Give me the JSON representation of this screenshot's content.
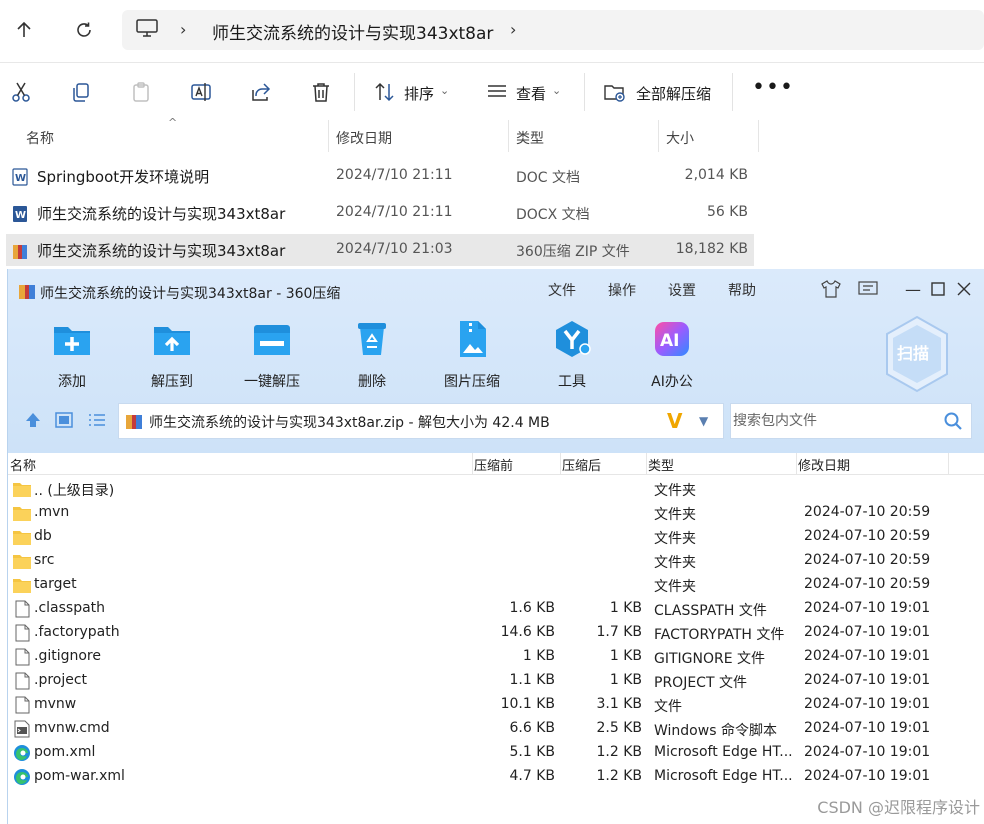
{
  "explorer": {
    "path": "师生交流系统的设计与实现343xt8ar",
    "toolbar": {
      "sort_label": "排序",
      "view_label": "查看",
      "extract_all_label": "全部解压缩"
    },
    "columns": {
      "name": "名称",
      "date": "修改日期",
      "type": "类型",
      "size": "大小"
    },
    "files": [
      {
        "name": "Springboot开发环境说明",
        "date": "2024/7/10 21:11",
        "type": "DOC 文档",
        "size": "2,014 KB"
      },
      {
        "name": "师生交流系统的设计与实现343xt8ar",
        "date": "2024/7/10 21:11",
        "type": "DOCX 文档",
        "size": "56 KB"
      },
      {
        "name": "师生交流系统的设计与实现343xt8ar",
        "date": "2024/7/10 21:03",
        "type": "360压缩 ZIP 文件",
        "size": "18,182 KB"
      }
    ]
  },
  "zip": {
    "title": "师生交流系统的设计与实现343xt8ar - 360压缩",
    "menu": [
      "文件",
      "操作",
      "设置",
      "帮助"
    ],
    "buttons": [
      "添加",
      "解压到",
      "一键解压",
      "删除",
      "图片压缩",
      "工具",
      "AI办公"
    ],
    "scan_label": "扫描",
    "ai_badge": "AI",
    "path_text": "师生交流系统的设计与实现343xt8ar.zip - 解包大小为 42.4 MB",
    "search_placeholder": "搜索包内文件",
    "columns": {
      "name": "名称",
      "before": "压缩前",
      "after": "压缩后",
      "type": "类型",
      "date": "修改日期"
    },
    "rows": [
      {
        "icon": "folder-icon",
        "name": ".. (上级目录)",
        "before": "",
        "after": "",
        "type": "文件夹",
        "date": ""
      },
      {
        "icon": "folder-icon",
        "name": ".mvn",
        "before": "",
        "after": "",
        "type": "文件夹",
        "date": "2024-07-10 20:59"
      },
      {
        "icon": "folder-icon",
        "name": "db",
        "before": "",
        "after": "",
        "type": "文件夹",
        "date": "2024-07-10 20:59"
      },
      {
        "icon": "folder-icon",
        "name": "src",
        "before": "",
        "after": "",
        "type": "文件夹",
        "date": "2024-07-10 20:59"
      },
      {
        "icon": "folder-icon",
        "name": "target",
        "before": "",
        "after": "",
        "type": "文件夹",
        "date": "2024-07-10 20:59"
      },
      {
        "icon": "file-icon",
        "name": ".classpath",
        "before": "1.6 KB",
        "after": "1 KB",
        "type": "CLASSPATH 文件",
        "date": "2024-07-10 19:01"
      },
      {
        "icon": "file-icon",
        "name": ".factorypath",
        "before": "14.6 KB",
        "after": "1.7 KB",
        "type": "FACTORYPATH 文件",
        "date": "2024-07-10 19:01"
      },
      {
        "icon": "file-icon",
        "name": ".gitignore",
        "before": "1 KB",
        "after": "1 KB",
        "type": "GITIGNORE 文件",
        "date": "2024-07-10 19:01"
      },
      {
        "icon": "file-icon",
        "name": ".project",
        "before": "1.1 KB",
        "after": "1 KB",
        "type": "PROJECT 文件",
        "date": "2024-07-10 19:01"
      },
      {
        "icon": "file-icon",
        "name": "mvnw",
        "before": "10.1 KB",
        "after": "3.1 KB",
        "type": "文件",
        "date": "2024-07-10 19:01"
      },
      {
        "icon": "cmd-file-icon",
        "name": "mvnw.cmd",
        "before": "6.6 KB",
        "after": "2.5 KB",
        "type": "Windows 命令脚本",
        "date": "2024-07-10 19:01"
      },
      {
        "icon": "edge-icon",
        "name": "pom.xml",
        "before": "5.1 KB",
        "after": "1.2 KB",
        "type": "Microsoft Edge HT...",
        "date": "2024-07-10 19:01"
      },
      {
        "icon": "edge-icon",
        "name": "pom-war.xml",
        "before": "4.7 KB",
        "after": "1.2 KB",
        "type": "Microsoft Edge HT...",
        "date": "2024-07-10 19:01"
      }
    ]
  },
  "watermark": "CSDN @迟限程序设计"
}
